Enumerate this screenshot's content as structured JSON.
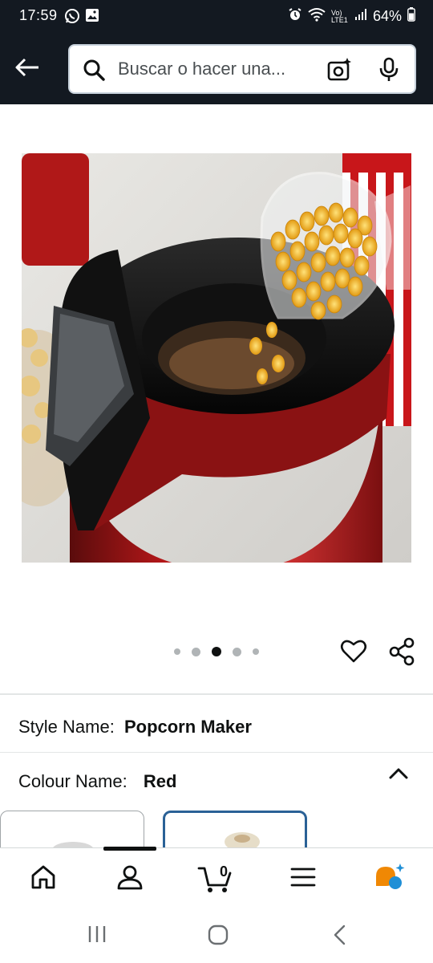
{
  "status_bar": {
    "time": "17:59",
    "battery": "64%",
    "network": "Vo) LTE1",
    "left_icons": [
      "whatsapp-icon",
      "gallery-icon"
    ],
    "right_icons": [
      "alarm-icon",
      "wifi-icon",
      "signal-icon",
      "battery-icon"
    ]
  },
  "header": {
    "background": "#131921",
    "back_icon": "arrow-left-icon",
    "search": {
      "placeholder": "Buscar o hacer una...",
      "value": ""
    },
    "camera_icon": "camera-scan-icon",
    "mic_icon": "microphone-icon"
  },
  "gallery": {
    "image_subject": "popcorn-maker",
    "dot_count": 5,
    "active_dot": 3,
    "wishlist_icon": "heart-icon",
    "share_icon": "share-icon"
  },
  "variations": {
    "style": {
      "label": "Style Name:",
      "value": "Popcorn Maker"
    },
    "colour": {
      "label": "Colour Name:",
      "value": "Red"
    },
    "collapse_icon": "chevron-up-icon"
  },
  "bottom_nav": {
    "items": [
      "home-icon",
      "account-icon",
      "cart-icon",
      "menu-icon",
      "rufus-icon"
    ],
    "cart_count": "0",
    "active": "account-icon"
  },
  "system_nav": [
    "recent-apps-icon",
    "home-circle-icon",
    "back-chevron-icon"
  ],
  "colors": {
    "accent_orange": "#f08804",
    "accent_blue": "#1f8fd6",
    "selected_swatch_border": "#2a6196"
  }
}
